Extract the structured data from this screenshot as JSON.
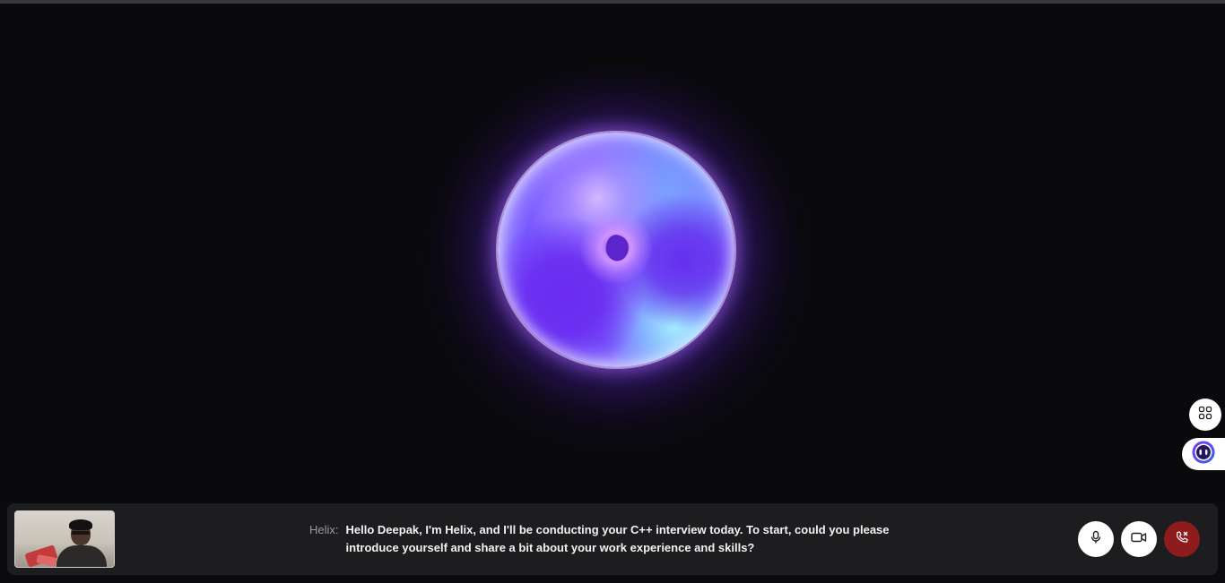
{
  "caption": {
    "speaker": "Helix:",
    "message": "Hello Deepak, I'm Helix, and I'll be conducting your C++ interview today. To start, could you please introduce yourself and share a bit about your work experience and skills?"
  },
  "controls": {
    "mic": "microphone-icon",
    "camera": "video-camera-icon",
    "end_call": "end-call-icon"
  },
  "side_buttons": {
    "apps": "apps-grid-icon",
    "assistant": "assistant-icon"
  },
  "colors": {
    "background": "#0a0a0c",
    "bar": "#1d1d20",
    "end_call": "#8f1c1c",
    "orb_accent": "#6a2cf0"
  }
}
